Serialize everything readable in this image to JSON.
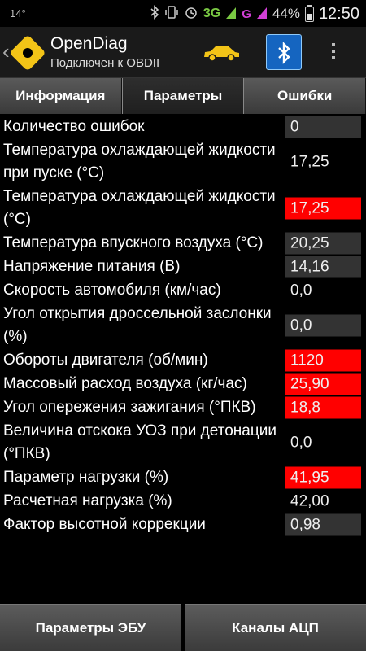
{
  "status_bar": {
    "left_text": "14°",
    "net_3g": "3G",
    "net_g": "G",
    "battery": "44%",
    "time": "12:50",
    "icons": [
      "bluetooth-icon",
      "vibrate-icon",
      "alarm-icon",
      "signal-icon",
      "battery-icon"
    ]
  },
  "action_bar": {
    "title": "OpenDiag",
    "subtitle": "Подключен к OBDII",
    "icons": [
      "app-logo-icon",
      "car-icon",
      "bluetooth-icon",
      "overflow-menu-icon"
    ],
    "colors": {
      "car": "#f3c417",
      "bluetooth": "#1565c0"
    }
  },
  "tabs": [
    {
      "label": "Информация",
      "active": false
    },
    {
      "label": "Параметры",
      "active": true
    },
    {
      "label": "Ошибки",
      "active": false
    }
  ],
  "params": [
    {
      "label": "Количество ошибок",
      "value": "0",
      "style": "dark"
    },
    {
      "label": "Температура охлаждающей жидкости при пуске (°C)",
      "value": "17,25",
      "style": "none"
    },
    {
      "label": "Температура охлаждающей жидкости (°C)",
      "value": "17,25",
      "style": "red"
    },
    {
      "label": "Температура впускного воздуха (°C)",
      "value": "20,25",
      "style": "dark"
    },
    {
      "label": "Напряжение питания (В)",
      "value": "14,16",
      "style": "dark"
    },
    {
      "label": "Скорость автомобиля (км/час)",
      "value": "0,0",
      "style": "none"
    },
    {
      "label": "Угол открытия дроссельной заслонки (%)",
      "value": "0,0",
      "style": "dark"
    },
    {
      "label": "Обороты двигателя (об/мин)",
      "value": "1120",
      "style": "red"
    },
    {
      "label": "Массовый расход воздуха (кг/час)",
      "value": "25,90",
      "style": "red"
    },
    {
      "label": "Угол опережения зажигания (°ПКВ)",
      "value": "18,8",
      "style": "red"
    },
    {
      "label": "Величина отскока УОЗ при детонации (°ПКВ)",
      "value": "0,0",
      "style": "none"
    },
    {
      "label": "Параметр нагрузки (%)",
      "value": "41,95",
      "style": "red"
    },
    {
      "label": "Расчетная нагрузка (%)",
      "value": "42,00",
      "style": "none"
    },
    {
      "label": "Фактор высотной коррекции",
      "value": "0,98",
      "style": "dark"
    }
  ],
  "bottom_buttons": [
    {
      "label": "Параметры ЭБУ"
    },
    {
      "label": "Каналы АЦП"
    }
  ]
}
